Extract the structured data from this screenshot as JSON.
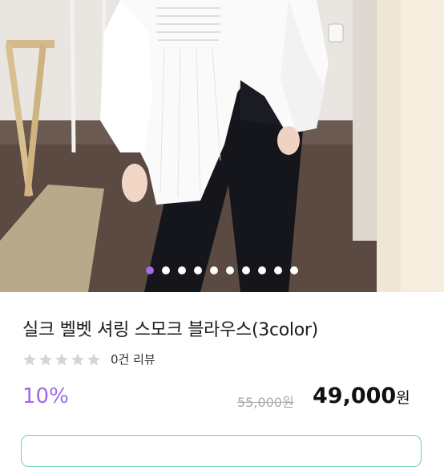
{
  "product": {
    "title": "실크 벨벳 셔링 스모크 블라우스(3color)",
    "review_count": "0건 리뷰",
    "rating_stars": 5,
    "rating_value": 0,
    "discount": "10%",
    "original_price": "55,000원",
    "sale_price": "49,000",
    "sale_currency": "원"
  },
  "carousel": {
    "total_slides": 10,
    "active_index": 0
  },
  "colors": {
    "accent": "#a66be3",
    "star_empty": "#d6d6d6",
    "button_border": "#6fd1a3"
  }
}
